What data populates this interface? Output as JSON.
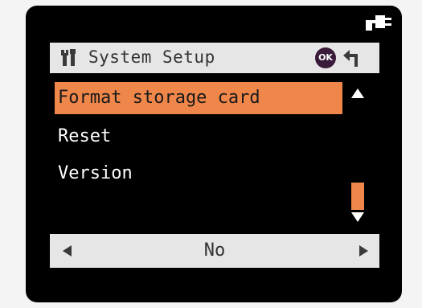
{
  "header": {
    "title": "System Setup",
    "ok_label": "OK"
  },
  "menu": {
    "items": [
      {
        "label": "Format storage card",
        "selected": true
      },
      {
        "label": "Reset",
        "selected": false
      },
      {
        "label": "Version",
        "selected": false
      }
    ]
  },
  "option": {
    "value": "No"
  },
  "icons": {
    "power": "power-plug-icon",
    "settings": "wrench-screwdriver-icon",
    "ok": "ok-button-icon",
    "back": "back-arrow-icon",
    "scroll_up": "triangle-up-icon",
    "scroll_down": "triangle-down-icon",
    "prev": "triangle-left-icon",
    "next": "triangle-right-icon"
  },
  "colors": {
    "accent": "#f0874a",
    "screen_bg": "#000000",
    "bar_bg": "#e6e6e6",
    "ok_bg": "#3a1a3a"
  }
}
